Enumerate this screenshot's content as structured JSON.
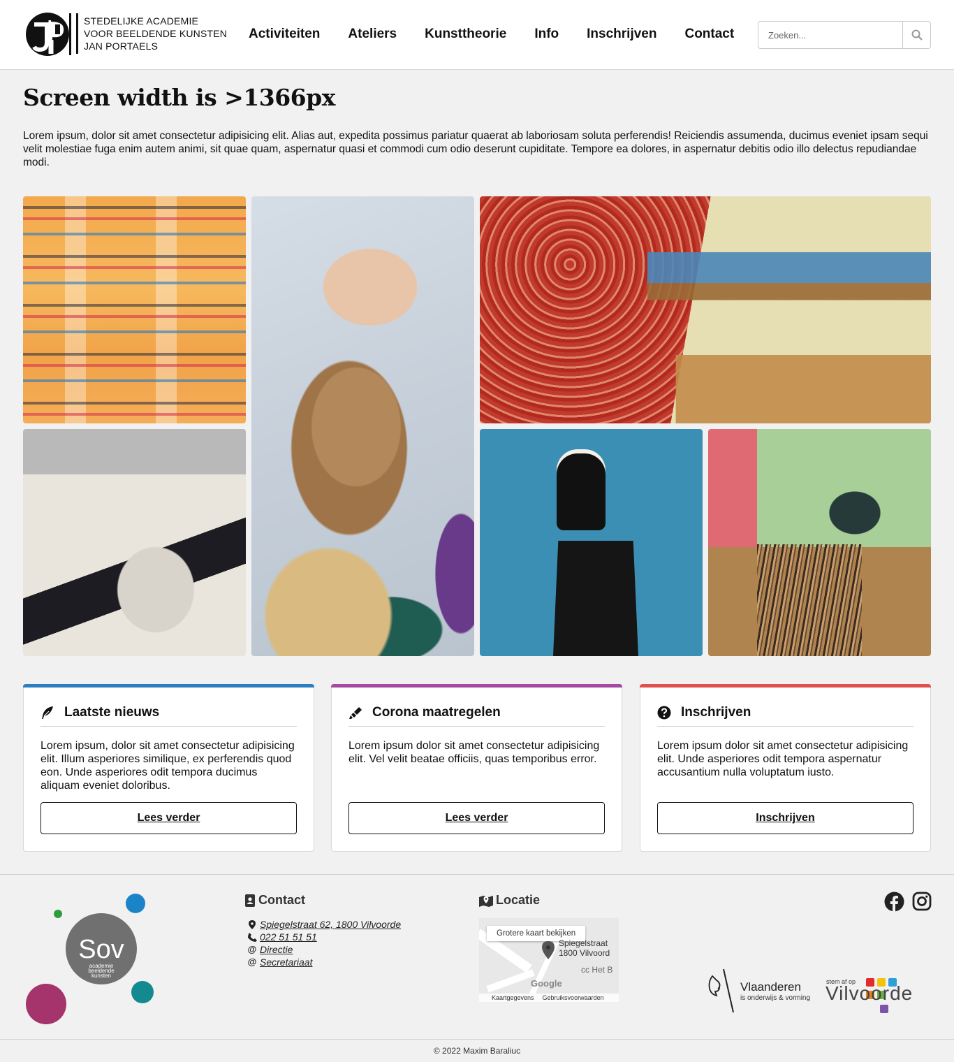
{
  "header": {
    "logo_lines": [
      "STEDELIJKE ACADEMIE",
      "VOOR BEELDENDE KUNSTEN",
      "JAN PORTAELS"
    ],
    "nav": [
      "Activiteiten",
      "Ateliers",
      "Kunsttheorie",
      "Info",
      "Inschrijven",
      "Contact"
    ],
    "search_placeholder": "Zoeken..."
  },
  "main": {
    "title": "Screen width is >1366px",
    "intro": "Lorem ipsum, dolor sit amet consectetur adipisicing elit. Alias aut, expedita possimus pariatur quaerat ab laboriosam soluta perferendis! Reiciendis assumenda, ducimus eveniet ipsam sequi velit molestiae fuga enim autem animi, sit quae quam, aspernatur quasi et commodi cum odio deserunt cupiditate. Tempore ea dolores, in aspernatur debitis odio illo delectus repudiandae modi."
  },
  "cards": [
    {
      "title": "Laatste nieuws",
      "icon": "feather-icon",
      "accent": "#2a7ec2",
      "body": "Lorem ipsum, dolor sit amet consectetur adipisicing elit. Illum asperiores similique, ex perferendis quod eon. Unde asperiores odit tempora ducimus aliquam eveniet doloribus.",
      "button": "Lees verder"
    },
    {
      "title": "Corona maatregelen",
      "icon": "highlighter-icon",
      "accent": "#a44aa3",
      "body": "Lorem ipsum dolor sit amet consectetur adipisicing elit. Vel velit beatae officiis, quas temporibus error.",
      "button": "Lees verder"
    },
    {
      "title": "Inschrijven",
      "icon": "question-circle-icon",
      "accent": "#e0504d",
      "body": "Lorem ipsum dolor sit amet consectetur adipisicing elit. Unde asperiores odit tempora aspernatur accusantium nulla voluptatum iusto.",
      "button": "Inschrijven"
    }
  ],
  "footer": {
    "sov_lines": [
      "Sov",
      "academie",
      "beeldende",
      "kunsten"
    ],
    "contact_title": "Contact",
    "contact_items": [
      {
        "icon": "map-pin-icon",
        "text": "Spiegelstraat 62, 1800 Vilvoorde"
      },
      {
        "icon": "phone-icon",
        "text": "022 51 51 51"
      },
      {
        "icon": "at-icon",
        "text": "Directie"
      },
      {
        "icon": "at-icon",
        "text": "Secretariaat"
      }
    ],
    "location_title": "Locatie",
    "map": {
      "bigger_map": "Grotere kaart bekijken",
      "address_line1": "Spiegelstraat",
      "address_line2": "1800 Vilvoord",
      "area": "cc Het B",
      "google": "Google",
      "map_data": "Kaartgegevens",
      "terms": "Gebruiksvoorwaarden"
    },
    "vlaanderen": {
      "name": "Vlaanderen",
      "sub": "is onderwijs & vorming"
    },
    "vilvoorde": {
      "small": "stem af op",
      "big": "Vilvoorde"
    },
    "copyright": "© 2022 Maxim Baraliuc"
  }
}
